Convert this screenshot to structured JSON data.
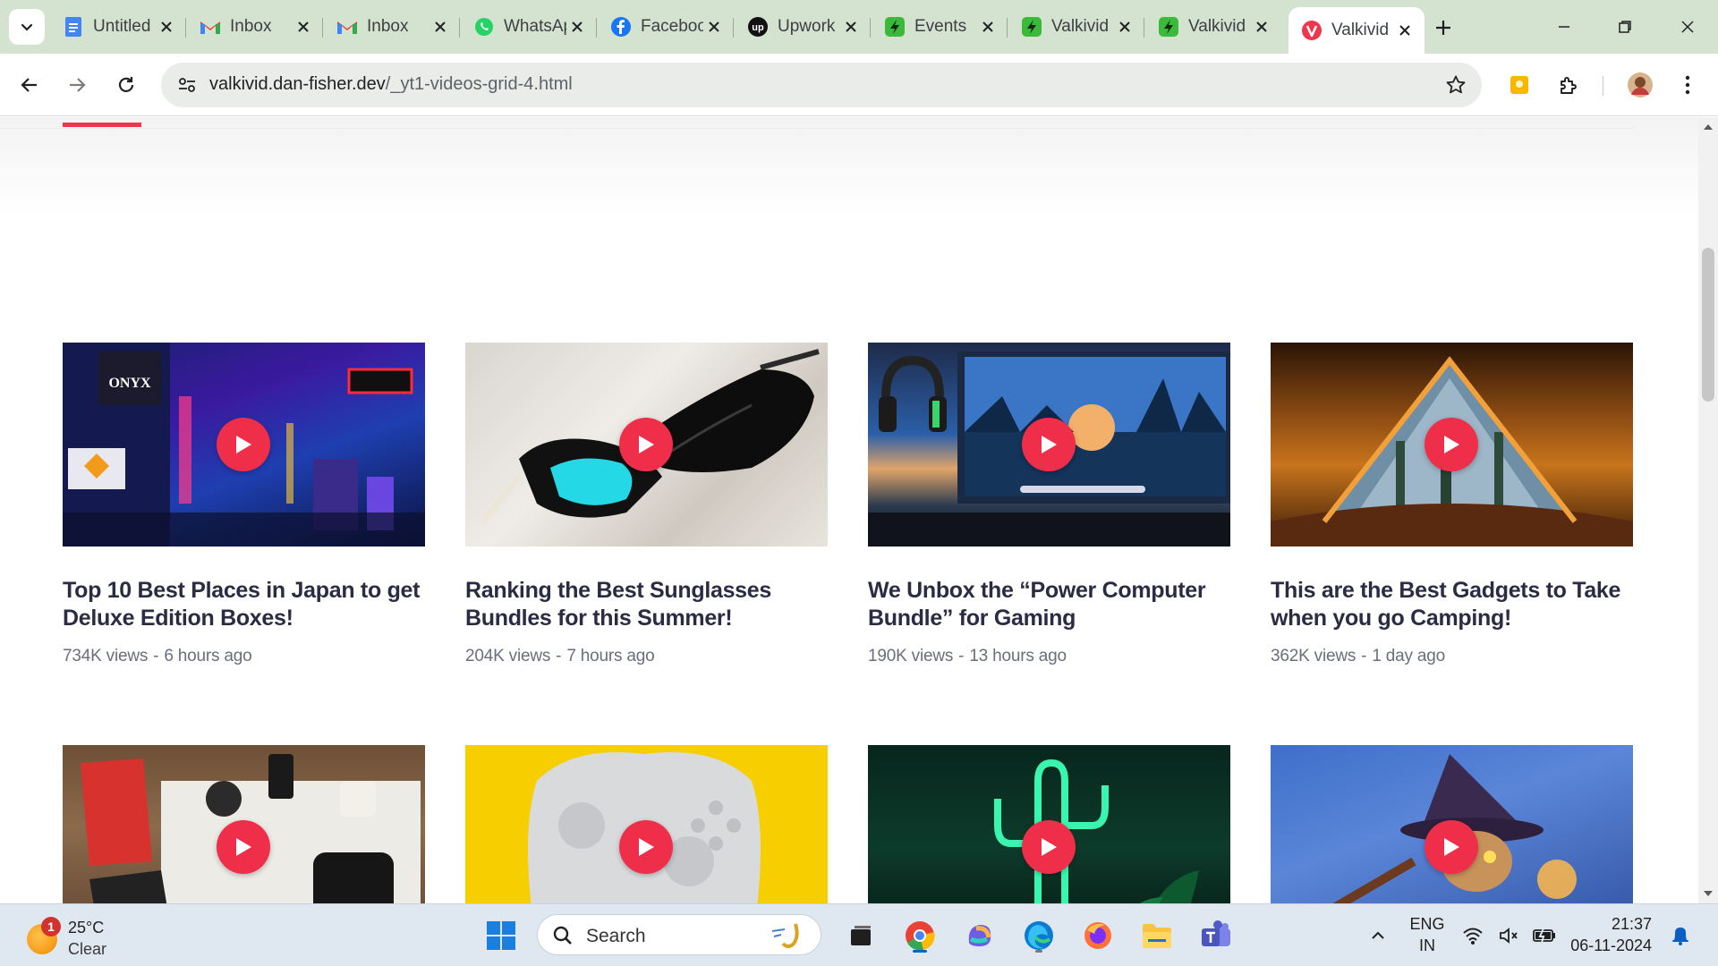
{
  "browser": {
    "tabs": [
      {
        "title": "Untitled",
        "icon": "google-docs-icon",
        "color": "#4285f4"
      },
      {
        "title": "Inbox",
        "icon": "gmail-icon",
        "color": "#ea4335"
      },
      {
        "title": "Inbox",
        "icon": "gmail-icon",
        "color": "#ea4335"
      },
      {
        "title": "WhatsApp",
        "icon": "whatsapp-icon",
        "color": "#25d366"
      },
      {
        "title": "Facebook",
        "icon": "facebook-icon",
        "color": "#1877f2"
      },
      {
        "title": "Upwork",
        "icon": "upwork-icon",
        "color": "#111111"
      },
      {
        "title": "Events",
        "icon": "green-bolt-icon",
        "color": "#3bb93b"
      },
      {
        "title": "Valkivid",
        "icon": "green-bolt-icon",
        "color": "#3bb93b"
      },
      {
        "title": "Valkivid",
        "icon": "green-bolt-icon",
        "color": "#3bb93b"
      },
      {
        "title": "Valkivid",
        "icon": "valkivid-icon",
        "color": "#f0364d",
        "active": true
      }
    ],
    "url_host": "valkivid.dan-fisher.dev",
    "url_path": "/_yt1-videos-grid-4.html"
  },
  "videos": [
    {
      "title": "Top 10 Best Places in Japan to get Deluxe Edition Boxes!",
      "views": "734K views",
      "age": "6 hours ago"
    },
    {
      "title": "Ranking the Best Sunglasses Bundles for this Summer!",
      "views": "204K views",
      "age": "7 hours ago"
    },
    {
      "title": "We Unbox the “Power Computer Bundle” for Gaming",
      "views": "190K views",
      "age": "13 hours ago"
    },
    {
      "title": "This are the Best Gadgets to Take when you go Camping!",
      "views": "362K views",
      "age": "1 day ago"
    },
    {
      "title": "",
      "views": "",
      "age": ""
    },
    {
      "title": "",
      "views": "",
      "age": ""
    },
    {
      "title": "",
      "views": "",
      "age": ""
    },
    {
      "title": "",
      "views": "",
      "age": ""
    }
  ],
  "meta_separator": "-",
  "taskbar": {
    "weather_temp": "25°C",
    "weather_cond": "Clear",
    "weather_badge": "1",
    "search_label": "Search",
    "lang_top": "ENG",
    "lang_bottom": "IN",
    "time": "21:37",
    "date": "06-11-2024"
  },
  "colors": {
    "accent": "#f0364d",
    "title_text": "#2b2c44",
    "meta_text": "#6b6e7c",
    "tabstrip_bg": "#d3e3d0"
  }
}
